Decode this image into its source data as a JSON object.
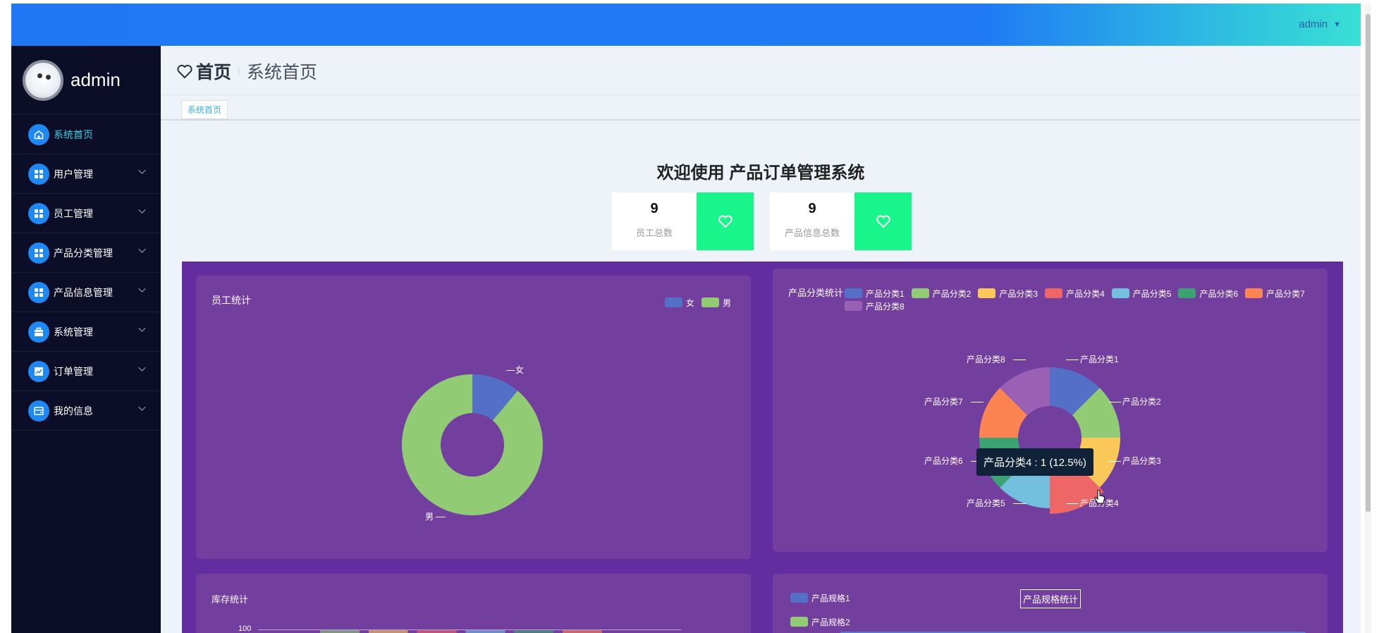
{
  "header": {
    "user_menu_label": "admin"
  },
  "sidebar": {
    "user_name": "admin",
    "items": [
      {
        "label": "系统首页",
        "icon": "home-icon",
        "active": true
      },
      {
        "label": "用户管理",
        "icon": "grid-icon"
      },
      {
        "label": "员工管理",
        "icon": "grid-icon"
      },
      {
        "label": "产品分类管理",
        "icon": "grid-icon"
      },
      {
        "label": "产品信息管理",
        "icon": "grid-icon"
      },
      {
        "label": "系统管理",
        "icon": "briefcase-icon"
      },
      {
        "label": "订单管理",
        "icon": "chart-icon"
      },
      {
        "label": "我的信息",
        "icon": "wallet-icon"
      }
    ]
  },
  "page": {
    "home_label": "首页",
    "title": "系统首页",
    "tab": "系统首页",
    "welcome": "欢迎使用 产品订单管理系统"
  },
  "stats": [
    {
      "value": "9",
      "label": "员工总数",
      "icon": "heart-icon"
    },
    {
      "value": "9",
      "label": "产品信息总数",
      "icon": "heart-icon"
    }
  ],
  "colors": {
    "accent": "#1e88f5",
    "stat_box": "#18f58a",
    "panel_bg": "#733f9f",
    "dashboard_bg": "#622d9e"
  },
  "chart_data": [
    {
      "type": "pie",
      "title": "员工统计",
      "legend": [
        "女",
        "男"
      ],
      "legend_position": "top-right",
      "slices": [
        {
          "name": "女",
          "value": 1,
          "color": "#5470c6"
        },
        {
          "name": "男",
          "value": 8,
          "color": "#91cc75"
        }
      ]
    },
    {
      "type": "pie",
      "title": "产品分类统计",
      "legend_position": "top",
      "slices": [
        {
          "name": "产品分类1",
          "value": 1,
          "color": "#5470c6"
        },
        {
          "name": "产品分类2",
          "value": 1,
          "color": "#91cc75"
        },
        {
          "name": "产品分类3",
          "value": 1,
          "color": "#fac858"
        },
        {
          "name": "产品分类4",
          "value": 1,
          "color": "#ee6666"
        },
        {
          "name": "产品分类5",
          "value": 1,
          "color": "#73c0de"
        },
        {
          "name": "产品分类6",
          "value": 1,
          "color": "#3ba272"
        },
        {
          "name": "产品分类7",
          "value": 1,
          "color": "#fc8452"
        },
        {
          "name": "产品分类8",
          "value": 1,
          "color": "#9a60b4"
        }
      ],
      "tooltip": "产品分类4 : 1 (12.5%)"
    },
    {
      "type": "bar",
      "title": "库存统计",
      "y_tick_top": "100"
    },
    {
      "type": "bar",
      "title": "产品规格统计",
      "legend": [
        {
          "name": "产品规格1",
          "color": "#5470c6"
        },
        {
          "name": "产品规格2",
          "color": "#91cc75"
        }
      ]
    }
  ]
}
